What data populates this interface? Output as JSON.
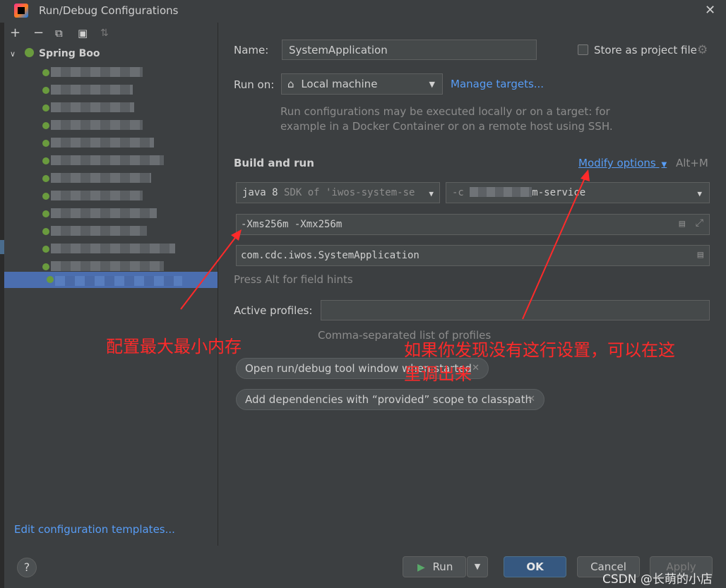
{
  "window": {
    "title": "Run/Debug Configurations",
    "close": "✕"
  },
  "toolbar": {
    "add": "+",
    "remove": "−",
    "copy": "⧉",
    "folder": "▣",
    "sort": "⇅"
  },
  "tree": {
    "root_label": "Spring Boo",
    "expand": "∨"
  },
  "left": {
    "edit_templates": "Edit configuration templates..."
  },
  "form": {
    "name_label": "Name:",
    "name_value": "SystemApplication",
    "store_label": "Store as project file",
    "run_on_label": "Run on:",
    "run_on_value": "Local machine",
    "manage_targets": "Manage targets...",
    "run_on_hint_1": "Run configurations may be executed locally or on a target: for",
    "run_on_hint_2": "example in a Docker Container or on a remote host using SSH.",
    "build_run_title": "Build and run",
    "modify_options": "Modify options",
    "modify_shortcut": "Alt+M",
    "sdk_value_main": "java 8",
    "sdk_value_rest": " SDK of 'iwos-system-se",
    "module_prefix": "-c",
    "module_suffix": "m-service",
    "vm_options": "-Xms256m -Xmx256m",
    "main_class": "com.cdc.iwos.SystemApplication",
    "field_hint": "Press Alt for field hints",
    "profiles_label": "Active profiles:",
    "profiles_value": "",
    "profiles_hint": "Comma-separated list of profiles"
  },
  "chips": [
    {
      "label": "Open run/debug tool window when started"
    },
    {
      "label": "Add dependencies with “provided” scope to classpath"
    }
  ],
  "annotations": {
    "memory": "配置最大最小内存",
    "modify_1": "如果你发现没有这行设置，可以在这",
    "modify_2": "里调出来"
  },
  "buttons": {
    "help": "?",
    "run": "Run",
    "ok": "OK",
    "cancel": "Cancel",
    "apply": "Apply"
  },
  "watermark": "CSDN @长萌的小店",
  "colors": {
    "background": "#3c3f41",
    "selection": "#4b6eaf",
    "link": "#589df6",
    "annotation": "#ff2a2a",
    "primary_button": "#365880"
  }
}
